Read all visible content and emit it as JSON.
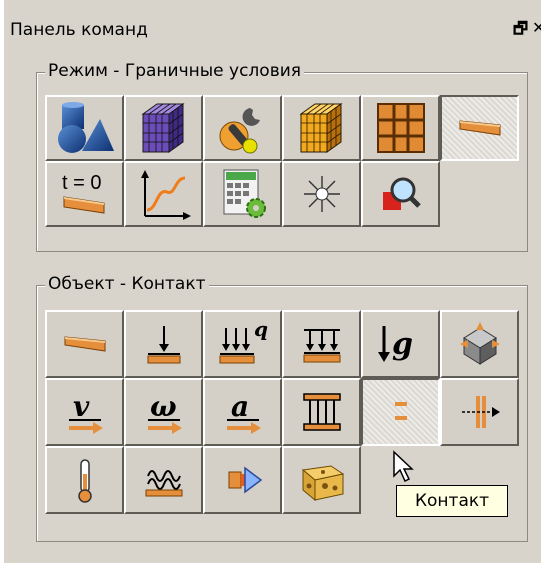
{
  "panel": {
    "title": "Панель команд",
    "restore_glyph": "🗗",
    "close_glyph": "✕"
  },
  "mode_group": {
    "label": "Режим - Граничные условия",
    "buttons": [
      {
        "icon": "geometry-shapes-icon",
        "state": "normal"
      },
      {
        "icon": "mesh-cube-icon",
        "state": "normal"
      },
      {
        "icon": "material-wrench-icon",
        "state": "normal"
      },
      {
        "icon": "volume-mesh-cube-icon",
        "state": "normal"
      },
      {
        "icon": "grid-partition-icon",
        "state": "normal"
      },
      {
        "icon": "boundary-conditions-plate-icon",
        "state": "pressed"
      },
      {
        "icon": "initial-conditions-icon",
        "text": "t = 0",
        "state": "normal"
      },
      {
        "icon": "curve-graph-icon",
        "state": "normal"
      },
      {
        "icon": "calculator-settings-icon",
        "state": "normal"
      },
      {
        "icon": "sparkle-icon",
        "state": "normal"
      },
      {
        "icon": "zoom-inspect-icon",
        "state": "normal"
      }
    ]
  },
  "object_group": {
    "label": "Объект - Контакт",
    "buttons": [
      {
        "icon": "plate-icon",
        "state": "normal"
      },
      {
        "icon": "force-arrow-icon",
        "state": "normal"
      },
      {
        "icon": "distributed-load-q-icon",
        "text": "q",
        "state": "normal"
      },
      {
        "icon": "pressure-load-icon",
        "state": "normal"
      },
      {
        "icon": "gravity-g-icon",
        "text": "↓g",
        "state": "normal"
      },
      {
        "icon": "constraint-3d-icon",
        "state": "normal"
      },
      {
        "icon": "velocity-v-icon",
        "text": "v",
        "state": "normal"
      },
      {
        "icon": "angular-velocity-omega-icon",
        "text": "ω",
        "state": "normal"
      },
      {
        "icon": "acceleration-a-icon",
        "text": "a",
        "state": "normal"
      },
      {
        "icon": "support-frame-icon",
        "state": "normal"
      },
      {
        "icon": "contact-icon",
        "state": "pressed"
      },
      {
        "icon": "connector-arrow-icon",
        "state": "normal"
      },
      {
        "icon": "thermometer-icon",
        "state": "normal"
      },
      {
        "icon": "spring-coil-icon",
        "state": "normal"
      },
      {
        "icon": "flow-arrow-icon",
        "state": "normal"
      },
      {
        "icon": "cheese-block-icon",
        "state": "normal"
      }
    ]
  },
  "tooltip": {
    "text": "Контакт"
  },
  "colors": {
    "background": "#d4d0c8",
    "plate_orange": "#e0893a",
    "tooltip_bg": "#ffffe1"
  }
}
